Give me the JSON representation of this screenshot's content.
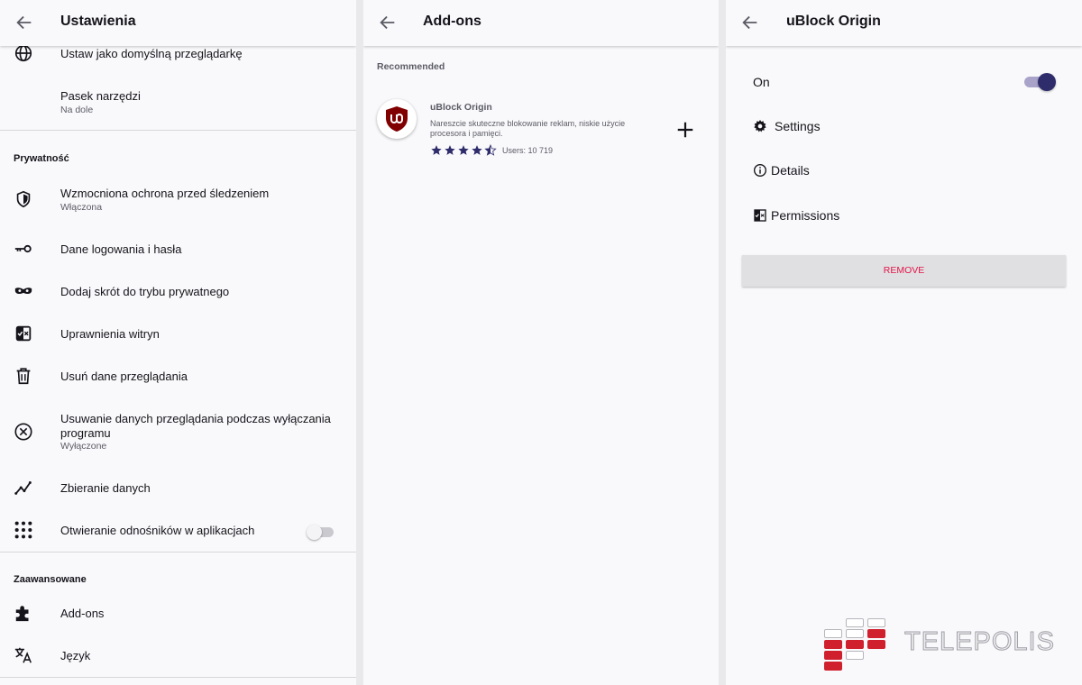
{
  "settings": {
    "title": "Ustawienia",
    "items": {
      "default_browser": {
        "label": "Ustaw jako domyślną przeglądarkę"
      },
      "toolbar": {
        "label": "Pasek narzędzi",
        "sub": "Na dole"
      },
      "tracking": {
        "label": "Wzmocniona ochrona przed śledzeniem",
        "sub": "Włączona"
      },
      "logins": {
        "label": "Dane logowania i hasła"
      },
      "private_shortcut": {
        "label": "Dodaj skrót do trybu prywatnego"
      },
      "site_permissions": {
        "label": "Uprawnienia witryn"
      },
      "delete_data": {
        "label": "Usuń dane przeglądania"
      },
      "delete_on_quit": {
        "label": "Usuwanie danych przeglądania podczas wyłączania programu",
        "sub": "Wyłączone"
      },
      "data_collection": {
        "label": "Zbieranie danych"
      },
      "open_links": {
        "label": "Otwieranie odnośników w aplikacjach",
        "toggle_on": false
      },
      "addons": {
        "label": "Add-ons"
      },
      "language": {
        "label": "Język"
      }
    },
    "sections": {
      "privacy": "Prywatność",
      "advanced": "Zaawansowane"
    }
  },
  "addons_page": {
    "title": "Add-ons",
    "recommended_label": "Recommended",
    "addon": {
      "name": "uBlock Origin",
      "description": "Nareszcie skuteczne blokowanie reklam, niskie użycie procesora i pamięci.",
      "rating": 4.5,
      "users": "Users: 10 719"
    }
  },
  "detail_page": {
    "title": "uBlock Origin",
    "on_label": "On",
    "enabled": true,
    "settings_label": "Settings",
    "details_label": "Details",
    "permissions_label": "Permissions",
    "remove_label": "REMOVE"
  },
  "watermark": {
    "text": "TELEPOLIS"
  },
  "colors": {
    "accent": "#2e2c6b",
    "remove": "#e2144a",
    "brand_red": "#d0202e"
  }
}
